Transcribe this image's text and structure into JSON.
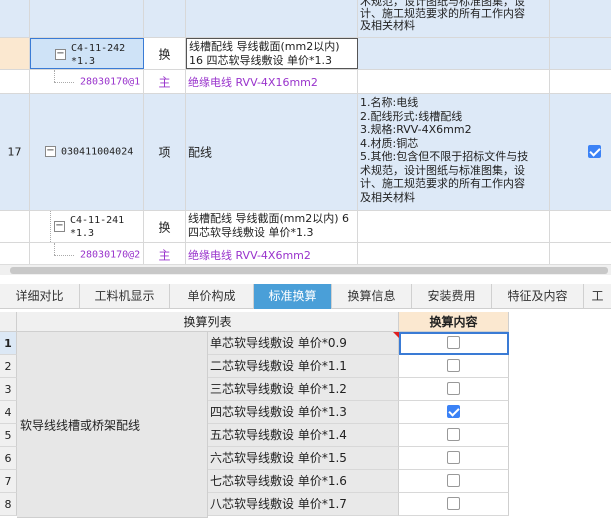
{
  "top_rows": [
    {
      "kind": "feature-tail",
      "feature_lines": [
        "术规范，设计图纸与标准图集，设",
        "计、施工规范要求的所有工作内容",
        "及相关材料"
      ]
    },
    {
      "kind": "sub",
      "code_lines": [
        "C4-11-242",
        "*1.3"
      ],
      "type": "换",
      "name_lines": [
        "线槽配线 导线截面(mm2以内)",
        "16  四芯软导线敷设 单价*1.3"
      ]
    },
    {
      "kind": "material",
      "code": "28030170@1",
      "type": "主",
      "name": "绝缘电线 RVV-4X16mm2"
    },
    {
      "kind": "item",
      "num": "17",
      "code": "030411004024",
      "type": "项",
      "name": "配线",
      "feature_lines": [
        "1.名称:电线",
        "2.配线形式:线槽配线",
        "3.规格:RVV-4X6mm2",
        "4.材质:铜芯",
        "5.其他:包含但不限于招标文件与技",
        "术规范，设计图纸与标准图集，设",
        "计、施工规范要求的所有工作内容",
        "及相关材料"
      ],
      "checked": true
    },
    {
      "kind": "sub",
      "code_lines": [
        "C4-11-241",
        "*1.3"
      ],
      "type": "换",
      "name_lines": [
        "线槽配线 导线截面(mm2以内) 6",
        " 四芯软导线敷设 单价*1.3"
      ]
    },
    {
      "kind": "material",
      "code": "28030170@2",
      "type": "主",
      "name": "绝缘电线 RVV-4X6mm2"
    }
  ],
  "tabs": [
    "详细对比",
    "工料机显示",
    "单价构成",
    "标准换算",
    "换算信息",
    "安装费用",
    "特征及内容",
    "工"
  ],
  "active_tab": "标准换算",
  "grid": {
    "header_list": "换算列表",
    "header_content": "换算内容",
    "group_label": "软导线线槽或桥架配线",
    "options": [
      {
        "num": "1",
        "label": "单芯软导线敷设 单价*0.9",
        "checked": false
      },
      {
        "num": "2",
        "label": "二芯软导线敷设 单价*1.1",
        "checked": false
      },
      {
        "num": "3",
        "label": "三芯软导线敷设 单价*1.2",
        "checked": false
      },
      {
        "num": "4",
        "label": "四芯软导线敷设 单价*1.3",
        "checked": true
      },
      {
        "num": "5",
        "label": "五芯软导线敷设 单价*1.4",
        "checked": false
      },
      {
        "num": "6",
        "label": "六芯软导线敷设 单价*1.5",
        "checked": false
      },
      {
        "num": "7",
        "label": "七芯软导线敷设 单价*1.6",
        "checked": false
      },
      {
        "num": "8",
        "label": "八芯软导线敷设 单价*1.7",
        "checked": false
      }
    ]
  },
  "colors": {
    "accent": "#4a9fd8",
    "checkbox": "#3b82f6",
    "material_text": "#9933cc",
    "row_highlight": "#dde9f7"
  }
}
